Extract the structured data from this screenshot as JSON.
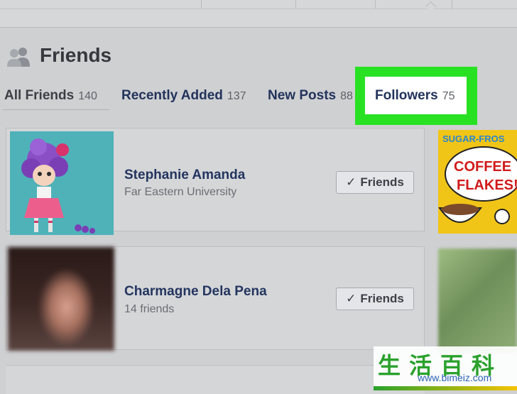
{
  "page": {
    "title": "Friends"
  },
  "tabs": [
    {
      "label": "All Friends",
      "count": "140",
      "active": true
    },
    {
      "label": "Recently Added",
      "count": "137"
    },
    {
      "label": "New Posts",
      "count": "88"
    },
    {
      "label": "Followers",
      "count": "75",
      "highlighted": true
    }
  ],
  "friends": [
    {
      "name": "Stephanie Amanda",
      "subtitle": "Far Eastern University",
      "button": "Friends"
    },
    {
      "name": "Charmagne Dela Pena",
      "subtitle": "14 friends",
      "button": "Friends"
    }
  ],
  "side_thumbnail": {
    "text_line1": "SUGAR-FROS",
    "text_line2": "COFFEE",
    "text_line3": "FLAKES!"
  },
  "watermark": {
    "chars": "生活百科",
    "url": "www.bimeiz.com"
  },
  "colors": {
    "highlight": "#28e123",
    "link": "#23355f",
    "page_bg": "#cfd0d2"
  },
  "icons": {
    "friends": "friends-icon",
    "check": "check-icon"
  }
}
